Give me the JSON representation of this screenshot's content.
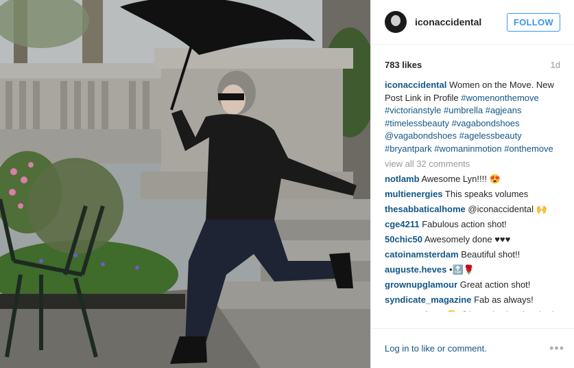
{
  "post": {
    "username": "iconaccidental",
    "follow_label": "FOLLOW",
    "likes": "783 likes",
    "age": "1d",
    "caption": {
      "username": "iconaccidental",
      "text": "Women on the Move. New Post Link in Profile",
      "hashtags": [
        "#womenonthemove",
        "#victorianstyle",
        "#umbrella",
        "#agjeans",
        "#timelessbeauty",
        "#vagabondshoes",
        "@vagabondshoes",
        "#agelessbeauty",
        "#bryantpark",
        "#womaninmotion",
        "#onthemove"
      ]
    },
    "view_all": "view all 32 comments",
    "comments": [
      {
        "user": "notlamb",
        "text": "Awesome Lyn!!!! 😍"
      },
      {
        "user": "multienergies",
        "text": "This speaks volumes"
      },
      {
        "user": "thesabbaticalhome",
        "text": "@iconaccidental 🙌"
      },
      {
        "user": "cge4211",
        "text": "Fabulous action shot!"
      },
      {
        "user": "50chic50",
        "text": "Awesomely done ♥♥♥"
      },
      {
        "user": "catoinamsterdam",
        "text": "Beautiful shot!!"
      },
      {
        "user": "auguste.heves",
        "text": "•🔝🌹"
      },
      {
        "user": "grownupglamour",
        "text": "Great action shot!"
      },
      {
        "user": "syndicate_magazine",
        "text": "Fab as always!"
      },
      {
        "user": "mayamayhem",
        "text": "😍 @lux_mize just lunched there today! She could def hang with the"
      }
    ],
    "footer_text": "Log in to like or comment.",
    "more_label": "•••"
  },
  "colors": {
    "link": "#125688",
    "accent": "#3897f0",
    "muted": "#999999"
  }
}
